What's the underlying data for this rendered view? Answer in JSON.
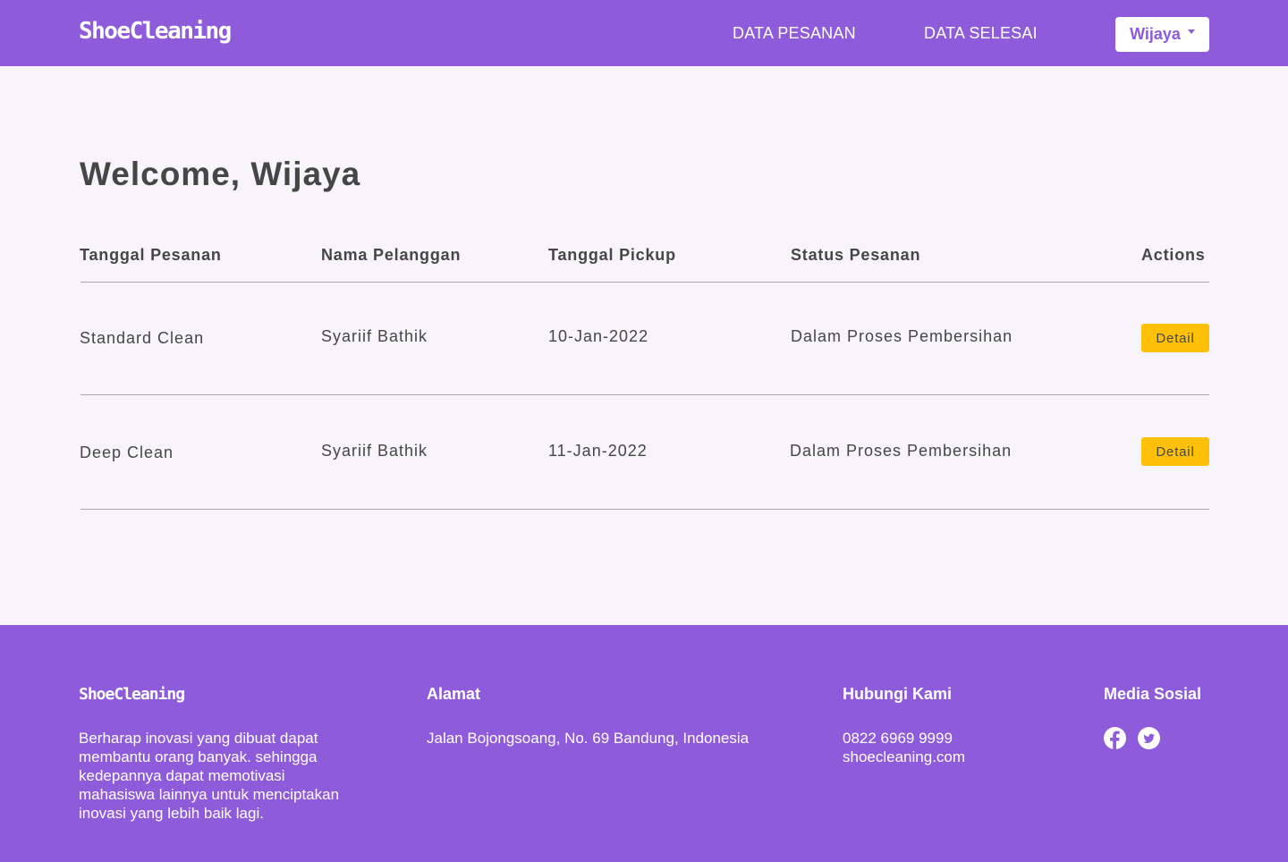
{
  "navbar": {
    "brand": "ShoeCleaning",
    "links": [
      "DATA PESANAN",
      "DATA SELESAI"
    ],
    "user": "Wijaya"
  },
  "main": {
    "welcome": "Welcome, Wijaya",
    "table": {
      "headers": [
        "Tanggal Pesanan",
        "Nama Pelanggan",
        "Tanggal Pickup",
        "Status Pesanan",
        "Actions"
      ],
      "rows": [
        {
          "tanggal_pesanan": "Standard Clean",
          "nama_pelanggan": "Syariif Bathik",
          "tanggal_pickup": "10-Jan-2022",
          "status": "Dalam Proses Pembersihan",
          "action": "Detail"
        },
        {
          "tanggal_pesanan": "Deep Clean",
          "nama_pelanggan": "Syariif Bathik",
          "tanggal_pickup": "11-Jan-2022",
          "status": "Dalam Proses Pembersihan",
          "action": "Detail"
        }
      ]
    }
  },
  "footer": {
    "brand": "ShoeCleaning",
    "about": "Berharap inovasi yang dibuat dapat membantu orang banyak. sehingga kedepannya dapat memotivasi mahasiswa lainnya untuk menciptakan inovasi yang lebih baik lagi.",
    "alamat": {
      "title": "Alamat",
      "text": "Jalan Bojongsoang, No. 69 Bandung, Indonesia"
    },
    "hubungi": {
      "title": "Hubungi Kami",
      "phone": "0822 6969 9999",
      "website": "shoecleaning.com"
    },
    "sosial": {
      "title": "Media Sosial",
      "icons": [
        "facebook-icon",
        "twitter-icon"
      ]
    }
  },
  "colors": {
    "brand_purple": "#8E5BDA",
    "background": "#F7F4FC",
    "button_yellow": "#FFC107",
    "text_dark": "#464646"
  }
}
